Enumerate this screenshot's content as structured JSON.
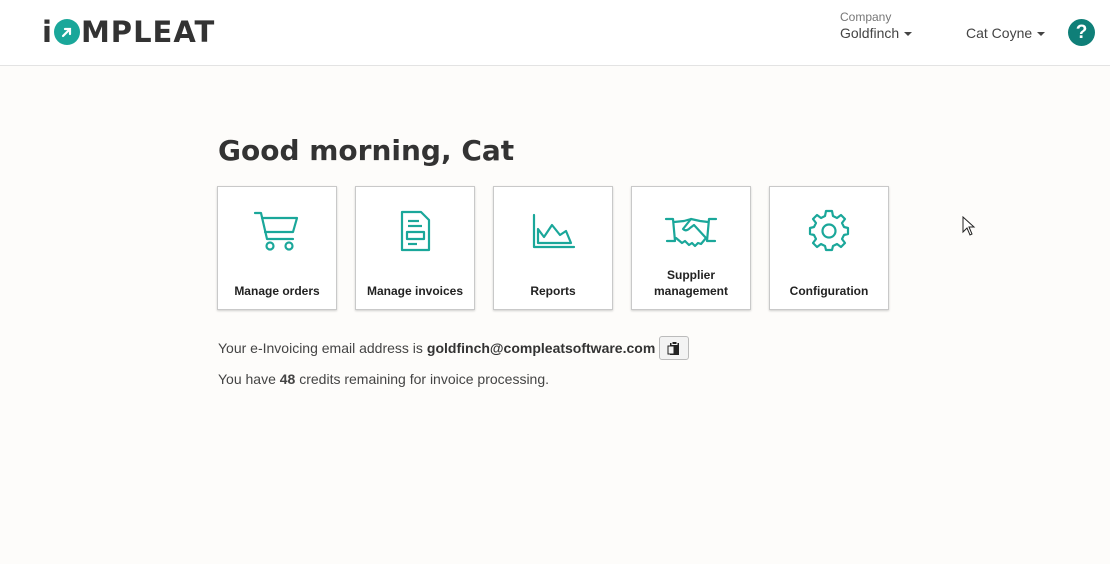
{
  "header": {
    "logo_pre": "i",
    "logo_post": "MPLEAT",
    "company_label": "Company",
    "company_value": "Goldfinch",
    "user_name": "Cat Coyne",
    "help_label": "?"
  },
  "main": {
    "greeting": "Good morning, Cat",
    "tiles": [
      {
        "label": "Manage orders",
        "icon": "cart-icon"
      },
      {
        "label": "Manage invoices",
        "icon": "invoice-icon"
      },
      {
        "label": "Reports",
        "icon": "chart-icon"
      },
      {
        "label": "Supplier management",
        "icon": "handshake-icon"
      },
      {
        "label": "Configuration",
        "icon": "gear-icon"
      }
    ],
    "email_prefix": "Your e-Invoicing email address is",
    "email_address": "goldfinch@compleatsoftware.com",
    "credits_prefix": "You have",
    "credits_count": "48",
    "credits_suffix": "credits remaining for invoice processing."
  },
  "colors": {
    "accent": "#1aa79a",
    "help": "#0f7f78"
  }
}
